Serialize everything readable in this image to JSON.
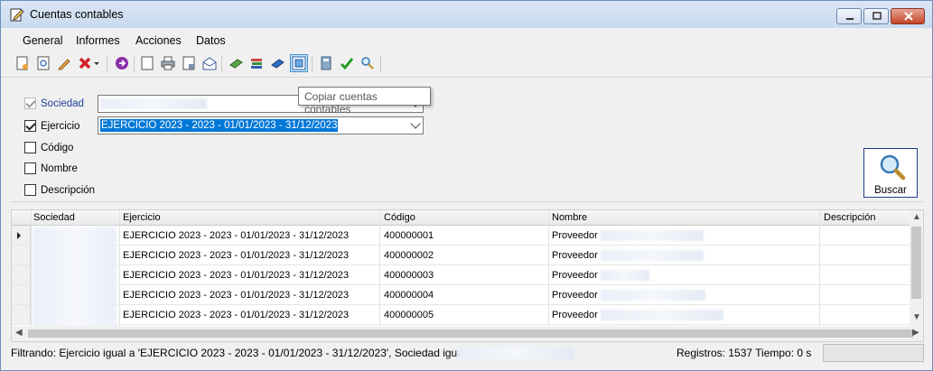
{
  "window": {
    "title": "Cuentas contables"
  },
  "menu": [
    "General",
    "Informes",
    "Acciones",
    "Datos"
  ],
  "toolbar": {
    "icons": [
      "new-document-icon",
      "preview-icon",
      "edit-pencil-icon",
      "delete-x-icon",
      "dropdown-arrow-icon",
      "navigate-icon",
      "blank-page-icon",
      "print-icon",
      "print-preview-icon",
      "open-envelope-icon",
      "green-book-icon",
      "books-stack-icon",
      "blue-book-icon",
      "copy-accounts-icon",
      "calculator-icon",
      "check-icon",
      "search-icon"
    ],
    "tooltip": "Copiar cuentas contables"
  },
  "filters": {
    "sociedad": {
      "label": "Sociedad",
      "checked": true,
      "disabled": true,
      "value": ""
    },
    "ejercicio": {
      "label": "Ejercicio",
      "checked": true,
      "value": "EJERCICIO 2023 - 2023 - 01/01/2023 - 31/12/2023"
    },
    "codigo": {
      "label": "Código",
      "checked": false
    },
    "nombre": {
      "label": "Nombre",
      "checked": false
    },
    "descripcion": {
      "label": "Descripción",
      "checked": false
    },
    "search_button": "Buscar"
  },
  "grid": {
    "columns": [
      "Sociedad",
      "Ejercicio",
      "Código",
      "Nombre",
      "Descripción"
    ],
    "rows": [
      {
        "ejercicio": "EJERCICIO 2023 - 2023 - 01/01/2023 - 31/12/2023",
        "codigo": "400000001",
        "nombre": "Proveedor"
      },
      {
        "ejercicio": "EJERCICIO 2023 - 2023 - 01/01/2023 - 31/12/2023",
        "codigo": "400000002",
        "nombre": "Proveedor"
      },
      {
        "ejercicio": "EJERCICIO 2023 - 2023 - 01/01/2023 - 31/12/2023",
        "codigo": "400000003",
        "nombre": "Proveedor"
      },
      {
        "ejercicio": "EJERCICIO 2023 - 2023 - 01/01/2023 - 31/12/2023",
        "codigo": "400000004",
        "nombre": "Proveedor"
      },
      {
        "ejercicio": "EJERCICIO 2023 - 2023 - 01/01/2023 - 31/12/2023",
        "codigo": "400000005",
        "nombre": "Proveedor"
      }
    ]
  },
  "status": {
    "filter_text": "Filtrando: Ejercicio igual a 'EJERCICIO 2023 - 2023 - 01/01/2023 - 31/12/2023', Sociedad igual a",
    "records": "Registros: 1537 Tiempo: 0 s"
  },
  "colors": {
    "selection": "#0078d7",
    "buscar_border": "#1e3d8a",
    "titlebar": "#c9daf0"
  }
}
